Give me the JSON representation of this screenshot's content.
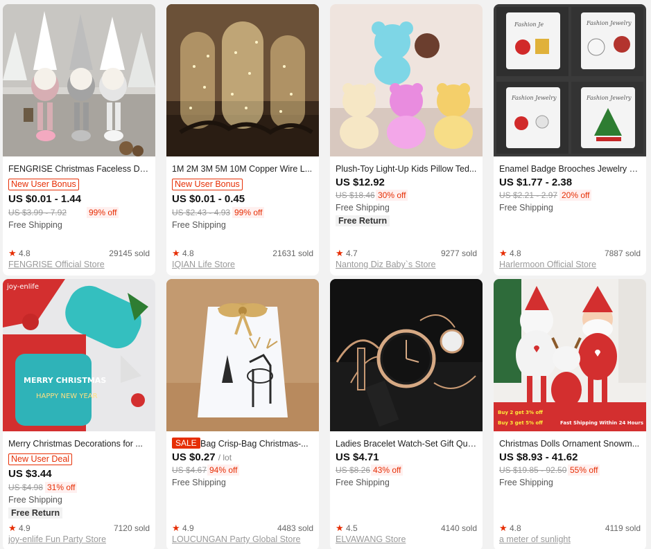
{
  "products": [
    {
      "title": "FENGRISE Christmas Faceless Doll ...",
      "badge": "New User Bonus",
      "price": "US $0.01 - 1.44",
      "original_price": "US $3.99 - 7.92",
      "discount": "99% off",
      "shipping": "Free Shipping",
      "rating": "4.8",
      "sold": "29145 sold",
      "store": "FENGRISE Official Store"
    },
    {
      "title": "1M 2M 3M 5M 10M Copper Wire L...",
      "badge": "New User Bonus",
      "price": "US $0.01 - 0.45",
      "original_price": "US $2.43 - 4.93",
      "discount": "99% off",
      "shipping": "Free Shipping",
      "rating": "4.8",
      "sold": "21631 sold",
      "store": "IQIAN Life Store"
    },
    {
      "title": "Plush-Toy Light-Up Kids Pillow Ted...",
      "price": "US $12.92",
      "original_price": "US $18.46",
      "discount": "30% off",
      "shipping": "Free Shipping",
      "free_return": "Free Return",
      "rating": "4.7",
      "sold": "9277 sold",
      "store": "Nantong Diz Baby`s Store"
    },
    {
      "title": "Enamel Badge Brooches Jewelry C...",
      "price": "US $1.77 - 2.38",
      "original_price": "US $2.21 - 2.97",
      "discount": "20% off",
      "shipping": "Free Shipping",
      "rating": "4.8",
      "sold": "7887 sold",
      "store": "Harlermoon Official Store",
      "image_text": [
        "Fashion Je",
        "Fashion Jewelry",
        "Fashion Jewelry",
        "Fashion Jewelry"
      ]
    },
    {
      "title": "Merry Christmas Decorations for ...",
      "badge": "New User Deal",
      "price": "US $3.44",
      "original_price": "US $4.98",
      "discount": "31% off",
      "shipping": "Free Shipping",
      "free_return": "Free Return",
      "rating": "4.9",
      "sold": "7120 sold",
      "store": "joy-enlife Fun Party Store",
      "image_text": [
        "joy-enlife",
        "MERRY CHRISTMAS",
        "HAPPY NEW YEAR"
      ]
    },
    {
      "sale_tag": "SALE",
      "title": "Bag Crisp-Bag Christmas-...",
      "price": "US $0.27",
      "unit": "/ lot",
      "original_price": "US $4.67",
      "discount": "94% off",
      "shipping": "Free Shipping",
      "rating": "4.9",
      "sold": "4483 sold",
      "store": "LOUCUNGAN Party Global Store"
    },
    {
      "title": "Ladies Bracelet Watch-Set Gift Qua...",
      "price": "US $4.71",
      "original_price": "US $8.26",
      "discount": "43% off",
      "shipping": "Free Shipping",
      "rating": "4.5",
      "sold": "4140 sold",
      "store": "ELVAWANG Store"
    },
    {
      "title": "Christmas Dolls Ornament Snowm...",
      "price": "US $8.93 - 41.62",
      "original_price": "US $19.85 - 92.50",
      "discount": "55% off",
      "shipping": "Free Shipping",
      "rating": "4.8",
      "sold": "4119 sold",
      "store": "a meter of sunlight",
      "image_text": [
        "Buy 2 get 3% off",
        "Buy 3 get 5% off",
        "Fast Shipping Within 24 Hours"
      ]
    }
  ],
  "colors": {
    "accent": "#e62e04",
    "card_bg": "#ffffff",
    "page_bg": "#f2f2f2"
  },
  "icons": {
    "rating": "star-icon"
  }
}
